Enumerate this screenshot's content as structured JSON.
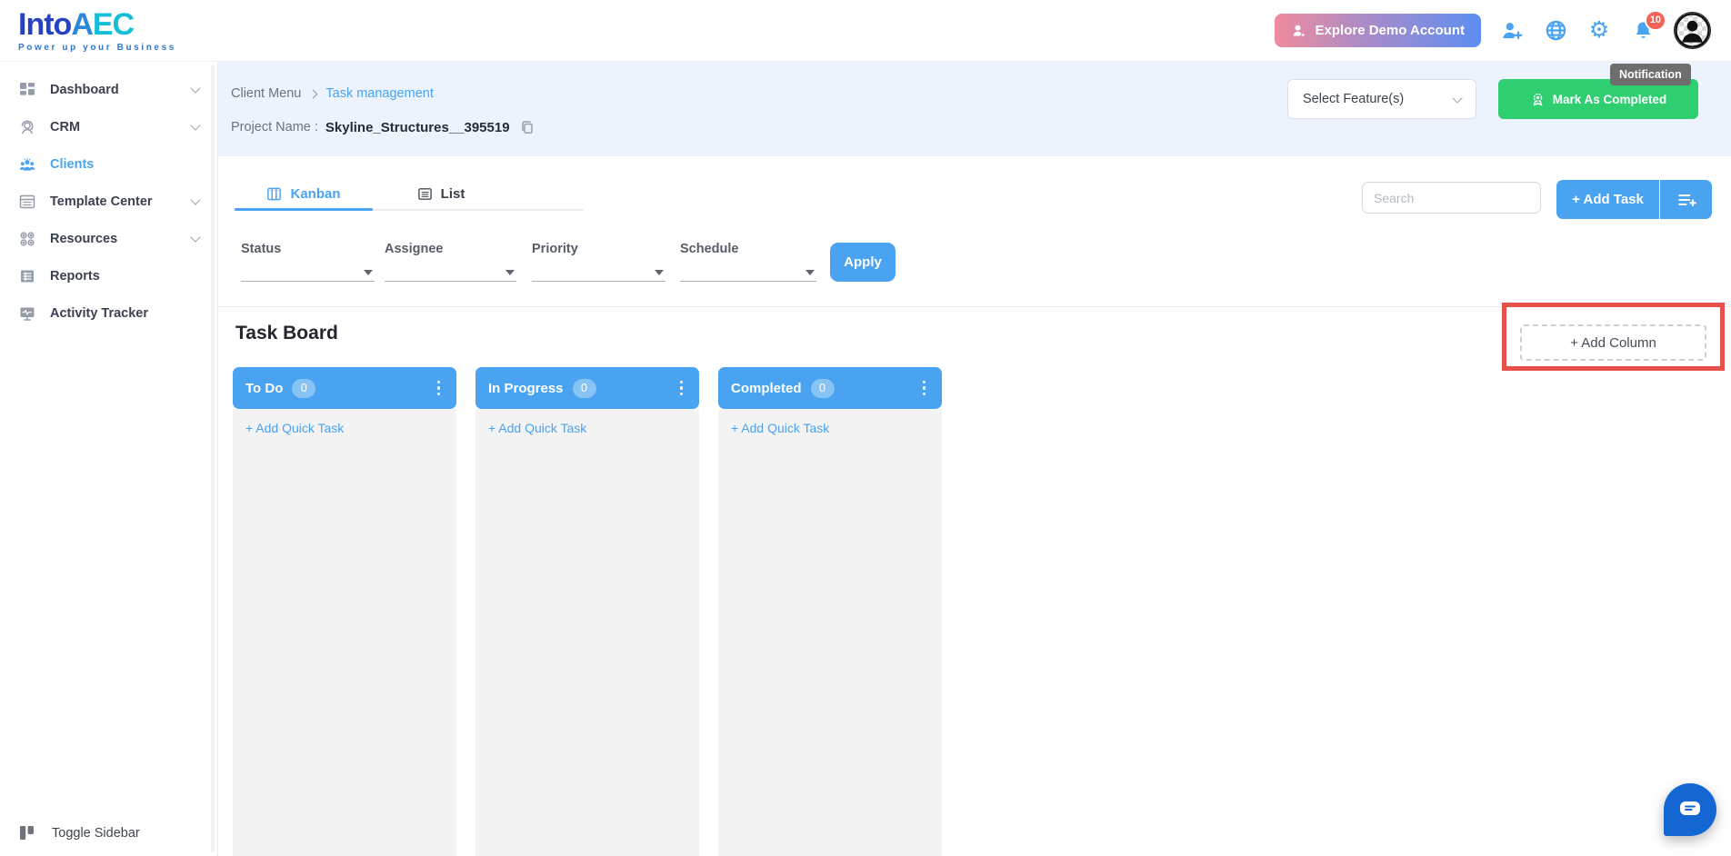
{
  "brand": {
    "prefix": "Into",
    "suffix": "AEC",
    "tagline": "Power up your Business"
  },
  "navbar": {
    "explore_label": "Explore Demo Account",
    "notification_count": "10",
    "tooltip": "Notification",
    "icons": [
      "person-add-icon",
      "globe-icon",
      "gear-icon",
      "bell-icon",
      "avatar"
    ]
  },
  "sidebar": {
    "items": [
      {
        "label": "Dashboard",
        "expandable": true,
        "active": false
      },
      {
        "label": "CRM",
        "expandable": true,
        "active": false
      },
      {
        "label": "Clients",
        "expandable": false,
        "active": true
      },
      {
        "label": "Template Center",
        "expandable": true,
        "active": false
      },
      {
        "label": "Resources",
        "expandable": true,
        "active": false
      },
      {
        "label": "Reports",
        "expandable": false,
        "active": false
      },
      {
        "label": "Activity Tracker",
        "expandable": false,
        "active": false
      }
    ],
    "toggle_label": "Toggle Sidebar"
  },
  "page_header": {
    "breadcrumb": {
      "parent": "Client Menu",
      "current": "Task management"
    },
    "project_label": "Project Name :",
    "project_name": "Skyline_Structures__395519",
    "select_features_label": "Select Feature(s)",
    "mark_completed_label": "Mark As Completed"
  },
  "view_tabs": {
    "kanban": "Kanban",
    "list": "List",
    "active": "Kanban"
  },
  "filters": {
    "status_label": "Status",
    "assignee_label": "Assignee",
    "priority_label": "Priority",
    "schedule_label": "Schedule",
    "apply_label": "Apply"
  },
  "toolbar": {
    "search_placeholder": "Search",
    "add_task_label": "+ Add Task"
  },
  "board": {
    "title": "Task Board",
    "add_column_label": "+ Add Column",
    "add_quick_task_label": "+ Add Quick Task",
    "columns": [
      {
        "name": "To Do",
        "count": "0"
      },
      {
        "name": "In Progress",
        "count": "0"
      },
      {
        "name": "Completed",
        "count": "0"
      }
    ]
  },
  "colors": {
    "accent_blue": "#49a3f1",
    "success_green": "#2fce71",
    "highlight_red": "#e8504c",
    "badge_red": "#f4635a",
    "gradient_pink": "#ef8b9d",
    "gradient_blue": "#5d8ef2",
    "header_band": "#edf3fc",
    "column_body": "#f3f3f4",
    "tooltip_bg": "#6e6e6e",
    "logo_blue": "#2742c0",
    "logo_teal": "#13bfd6"
  }
}
